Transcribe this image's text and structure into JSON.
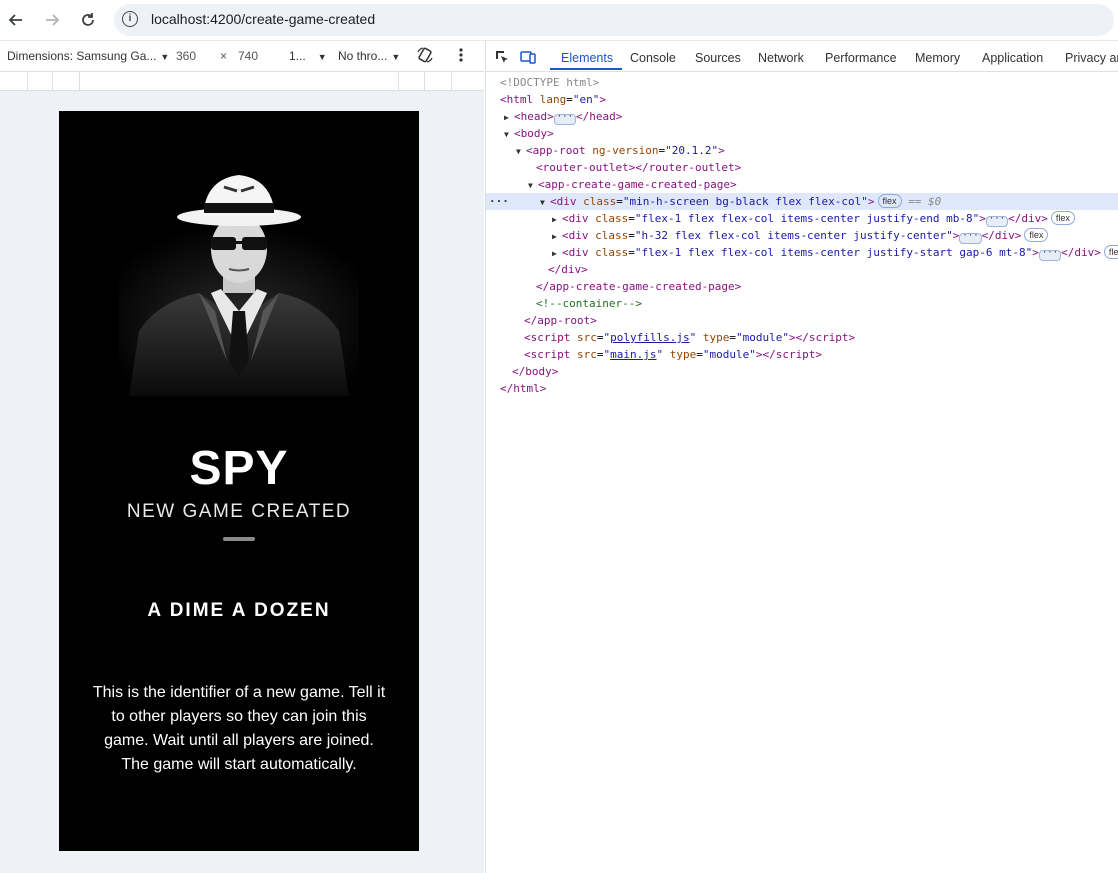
{
  "browser": {
    "url": "localhost:4200/create-game-created"
  },
  "emulation": {
    "device": "Dimensions: Samsung Ga...",
    "width": "360",
    "times": "×",
    "height": "740",
    "zoom": "1...",
    "throttle": "No thro..."
  },
  "devtools": {
    "tabs": [
      "Elements",
      "Console",
      "Sources",
      "Network",
      "Performance",
      "Memory",
      "Application",
      "Privacy an"
    ]
  },
  "app": {
    "title": "SPY",
    "subtitle": "NEW GAME CREATED",
    "game_id": "A DIME A DOZEN",
    "info": "This is the identifier of a new game. Tell it to other players so they can join this game. Wait until all players are joined. The game will start automatically."
  },
  "dom": {
    "doctype": "<!DOCTYPE html>",
    "html_lang": "\"en\"",
    "ng_version": "\"20.1.2\"",
    "div_main_class": "\"min-h-screen bg-black flex flex-col\"",
    "div1_class": "\"flex-1 flex flex-col items-center justify-end mb-8\"",
    "div2_class": "\"h-32 flex flex-col items-center justify-center\"",
    "div3_class": "\"flex-1 flex flex-col items-center justify-start gap-6 mt-8\"",
    "comment": "<!--container-->",
    "polyfills": "polyfills.js",
    "main": "main.js",
    "module": "\"module\"",
    "flex": "flex",
    "flex_short": "fle",
    "dollar": "== $0"
  },
  "colors": {
    "accent": "#1a56c8",
    "phone_bg": "#000000"
  }
}
